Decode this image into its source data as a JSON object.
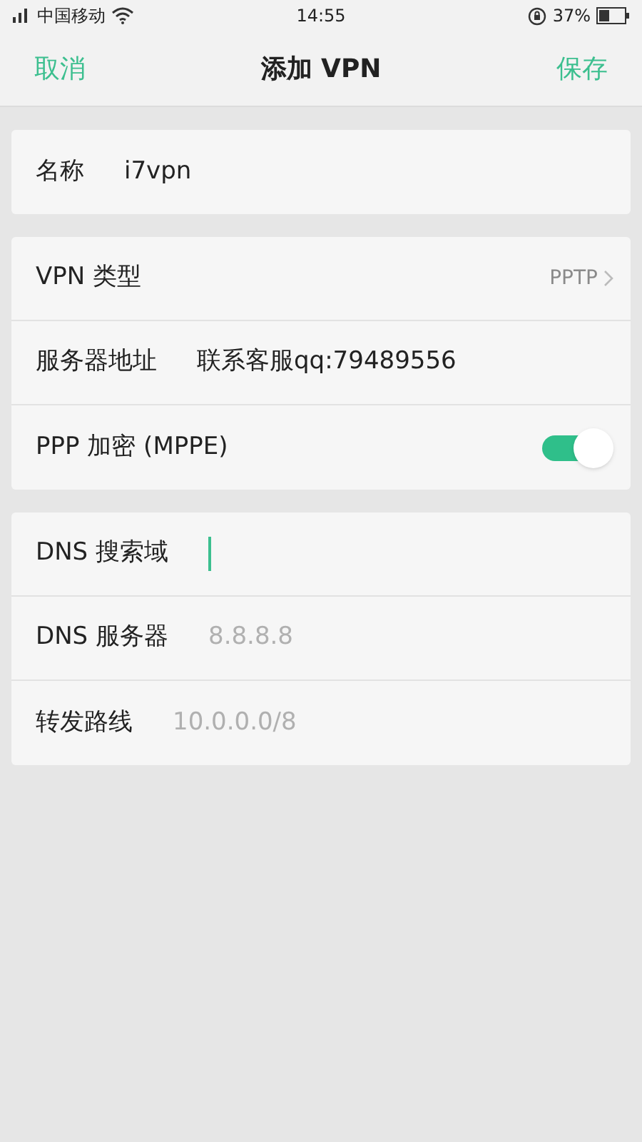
{
  "status_bar": {
    "carrier": "中国移动",
    "time": "14:55",
    "battery": "37%"
  },
  "header": {
    "cancel": "取消",
    "title": "添加 VPN",
    "save": "保存"
  },
  "groups": [
    {
      "rows": [
        {
          "kind": "field",
          "label": "名称",
          "value": "i7vpn",
          "focused": false
        }
      ]
    },
    {
      "rows": [
        {
          "kind": "select",
          "label": "VPN 类型",
          "value": "PPTP"
        },
        {
          "kind": "field",
          "label": "服务器地址",
          "value": "联系客服qq:79489556",
          "focused": false
        },
        {
          "kind": "switch",
          "label": "PPP 加密 (MPPE)",
          "on": true
        }
      ]
    },
    {
      "rows": [
        {
          "kind": "field",
          "label": "DNS 搜索域",
          "focused": true
        },
        {
          "kind": "field",
          "label": "DNS 服务器",
          "placeholder": "8.8.8.8",
          "focused": false
        },
        {
          "kind": "field",
          "label": "转发路线",
          "placeholder": "10.0.0.0/8",
          "focused": false
        }
      ]
    }
  ]
}
